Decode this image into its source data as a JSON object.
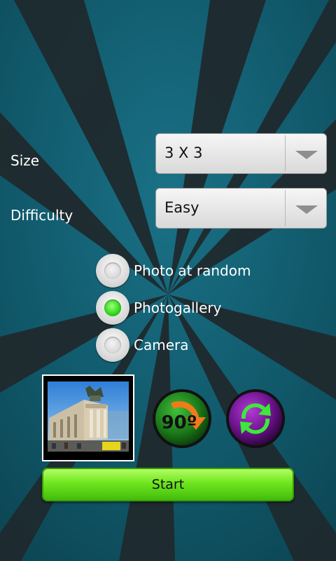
{
  "form": {
    "size_label": "Size",
    "size_value": "3 X 3",
    "difficulty_label": "Difficulty",
    "difficulty_value": "Easy"
  },
  "source_options": [
    {
      "label": "Photo at random",
      "checked": false
    },
    {
      "label": "Photogallery",
      "checked": true
    },
    {
      "label": "Camera",
      "checked": false
    }
  ],
  "actions": {
    "rotate_label": "90º",
    "rotate_icon": "rotate-90-icon",
    "refresh_icon": "refresh-icon",
    "start_label": "Start"
  },
  "colors": {
    "background": "#0f5565",
    "rotate_button": "#1c7a1a",
    "refresh_button": "#6a128a",
    "start_button": "#6fe61e"
  }
}
